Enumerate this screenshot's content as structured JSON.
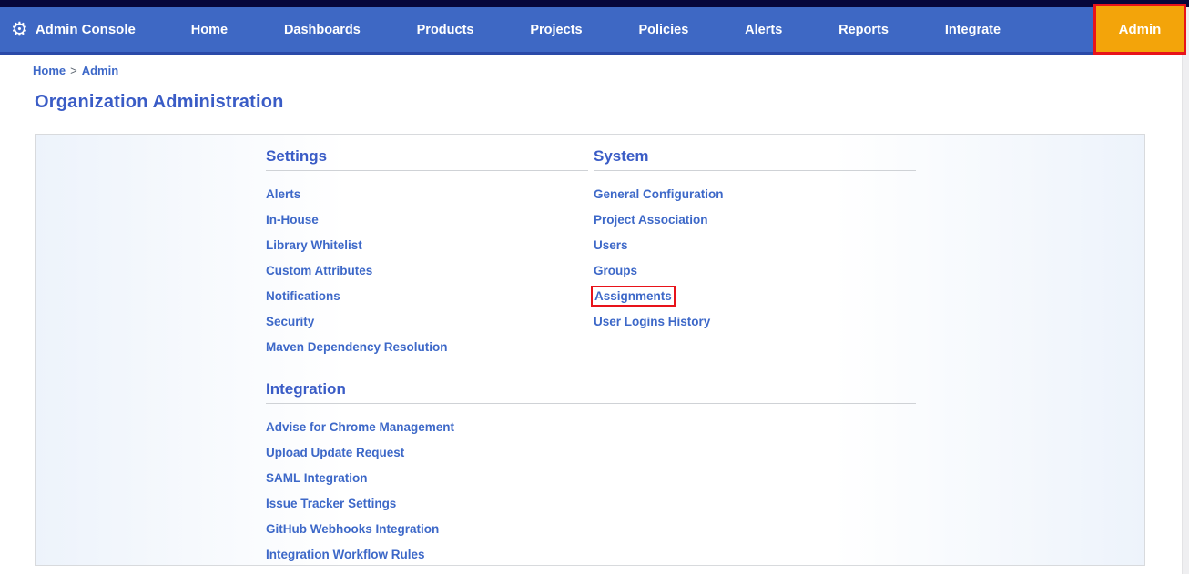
{
  "navbar": {
    "brand": "Admin Console",
    "brand_icon": "gear-icon",
    "items": [
      "Home",
      "Dashboards",
      "Products",
      "Projects",
      "Policies",
      "Alerts",
      "Reports",
      "Integrate"
    ],
    "admin_label": "Admin"
  },
  "breadcrumb": {
    "items": [
      "Home",
      "Admin"
    ],
    "separator": ">"
  },
  "page": {
    "title": "Organization Administration"
  },
  "sections": {
    "settings": {
      "title": "Settings",
      "links": [
        "Alerts",
        "In-House",
        "Library Whitelist",
        "Custom Attributes",
        "Notifications",
        "Security",
        "Maven Dependency Resolution"
      ]
    },
    "system": {
      "title": "System",
      "links": [
        "General Configuration",
        "Project Association",
        "Users",
        "Groups",
        "Assignments",
        "User Logins History"
      ],
      "highlighted": "Assignments"
    },
    "integration": {
      "title": "Integration",
      "links": [
        "Advise for Chrome Management",
        "Upload Update Request",
        "SAML Integration",
        "Issue Tracker Settings",
        "GitHub Webhooks Integration",
        "Integration Workflow Rules"
      ]
    }
  },
  "annotations": {
    "admin_nav_boxed": true,
    "assignments_link_boxed": true
  },
  "colors": {
    "navbar_bg": "#3e68c4",
    "navbar_top_strip": "#06063a",
    "navbar_bottom_border": "#2a4aa8",
    "admin_button_bg": "#f3a40a",
    "annotation_red": "#e8131a",
    "link_blue": "#3d68c8",
    "heading_blue": "#3a5cc6",
    "panel_edge_blue": "#edf3fb"
  }
}
